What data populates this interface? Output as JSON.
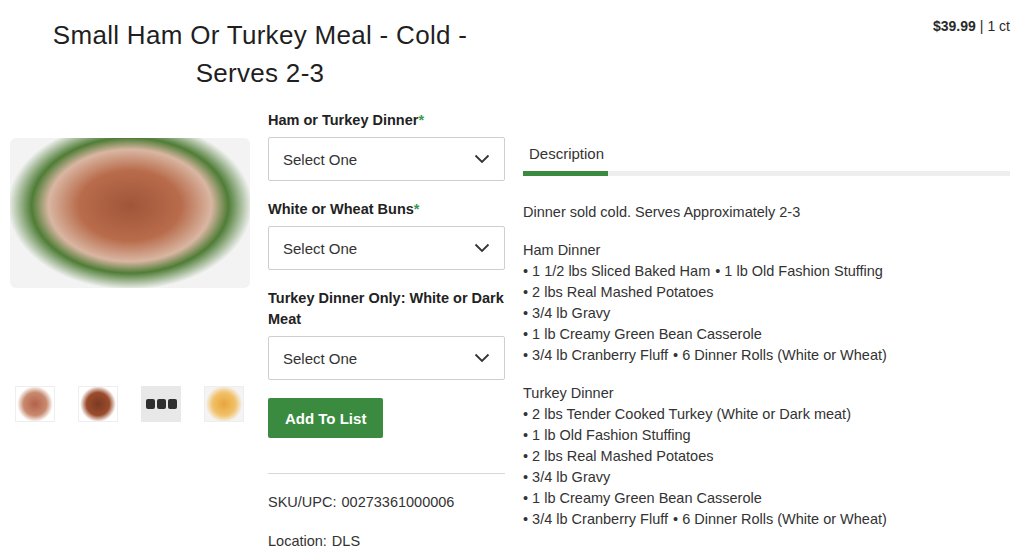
{
  "product": {
    "title": "Small Ham Or Turkey Meal - Cold - Serves 2-3",
    "price": "$39.99",
    "separator": "|",
    "unit": "1 ct"
  },
  "gallery": {
    "thumbnails": [
      {
        "kind": "ham"
      },
      {
        "kind": "roast"
      },
      {
        "kind": "containers"
      },
      {
        "kind": "rolls"
      }
    ]
  },
  "required_mark": "*",
  "options": [
    {
      "label": "Ham or Turkey Dinner",
      "required": true,
      "value": "Select One"
    },
    {
      "label": "White or Wheat Buns",
      "required": true,
      "value": "Select One"
    },
    {
      "label": "Turkey Dinner Only: White or Dark Meat",
      "required": false,
      "value": "Select One"
    }
  ],
  "button": "Add To List",
  "details": [
    {
      "label": "SKU/UPC:",
      "value": "00273361000006"
    },
    {
      "label": "Location:",
      "value": "DLS"
    }
  ],
  "tabs": [
    {
      "label": "Description",
      "selected": true
    }
  ],
  "description": {
    "intro": "Dinner sold cold. Serves Approximately 2-3",
    "bullet": "•",
    "sections": [
      {
        "title": "Ham Dinner",
        "lines": [
          [
            "1 1/2 lbs Sliced Baked Ham",
            "1 lb Old Fashion Stuffing"
          ],
          [
            "2 lbs Real Mashed Potatoes"
          ],
          [
            "3/4 lb Gravy"
          ],
          [
            "1 lb Creamy Green Bean Casserole"
          ],
          [
            "3/4 lb Cranberry Fluff",
            "6 Dinner Rolls (White or Wheat)"
          ]
        ]
      },
      {
        "title": "Turkey Dinner",
        "lines": [
          [
            "2 lbs Tender Cooked Turkey (White or Dark meat)"
          ],
          [
            "1 lb Old Fashion Stuffing"
          ],
          [
            "2 lbs Real Mashed Potatoes"
          ],
          [
            "3/4 lb Gravy"
          ],
          [
            "1 lb Creamy Green Bean Casserole"
          ],
          [
            "3/4 lb Cranberry Fluff",
            "6 Dinner Rolls (White or Wheat)"
          ]
        ]
      }
    ]
  }
}
